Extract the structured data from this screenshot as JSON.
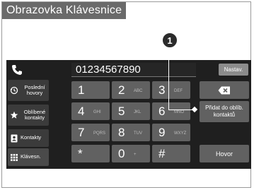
{
  "title": "Obrazovka Klávesnice",
  "callout_number": "1",
  "number_display": "01234567890",
  "settings_button": "Nastav.",
  "sidebar": {
    "items": [
      {
        "label": "Poslední hovory",
        "icon": "history-icon"
      },
      {
        "label": "Oblíbené kontakty",
        "icon": "star-icon"
      },
      {
        "label": "Kontakty",
        "icon": "contacts-icon"
      },
      {
        "label": "Klávesn.",
        "icon": "keypad-icon"
      }
    ]
  },
  "keypad": [
    {
      "digit": "1",
      "letters": ""
    },
    {
      "digit": "2",
      "letters": "ABC"
    },
    {
      "digit": "3",
      "letters": "DEF"
    },
    {
      "digit": "4",
      "letters": "GHI"
    },
    {
      "digit": "5",
      "letters": "JKL"
    },
    {
      "digit": "6",
      "letters": "MNO"
    },
    {
      "digit": "7",
      "letters": "PQRS"
    },
    {
      "digit": "8",
      "letters": "TUV"
    },
    {
      "digit": "9",
      "letters": "WXYZ"
    },
    {
      "digit": "*",
      "letters": ""
    },
    {
      "digit": "0",
      "letters": "+"
    },
    {
      "digit": "#",
      "letters": ""
    }
  ],
  "actions": {
    "add_favorite": "Přidat do oblíb. kontaktů",
    "call": "Hovor"
  }
}
